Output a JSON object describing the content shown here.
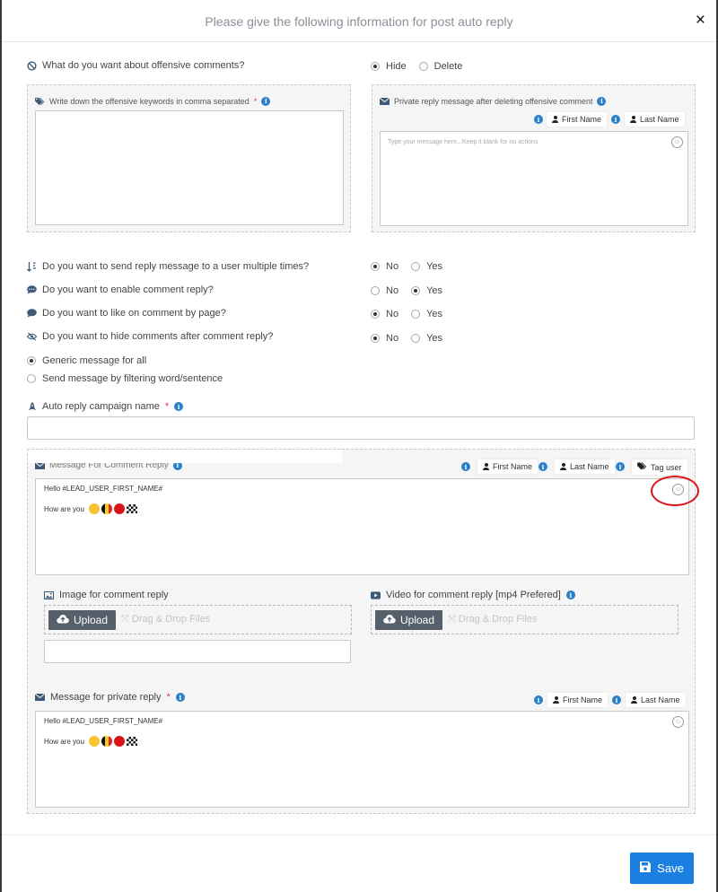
{
  "modal": {
    "title": "Please give the following information for post auto reply",
    "close_symbol": "×"
  },
  "offensive": {
    "question": "What do you want about offensive comments?",
    "options": [
      "Hide",
      "Delete"
    ],
    "selected": "Hide",
    "keywords_label": "Write down the offensive keywords in comma separated",
    "keywords_value": "",
    "private_label": "Private reply message after deleting offensive comment",
    "private_placeholder": "Type your message here...Keep it blank for no actions"
  },
  "chips": {
    "first_name": "First Name",
    "last_name": "Last Name",
    "tag_user": "Tag user"
  },
  "questions": [
    {
      "icon": "sort-icon",
      "text": "Do you want to send reply message to a user multiple times?",
      "options": [
        "No",
        "Yes"
      ],
      "selected": "No"
    },
    {
      "icon": "comment-dots-icon",
      "text": "Do you want to enable comment reply?",
      "options": [
        "No",
        "Yes"
      ],
      "selected": "Yes"
    },
    {
      "icon": "comment-icon",
      "text": "Do you want to like on comment by page?",
      "options": [
        "No",
        "Yes"
      ],
      "selected": "No"
    },
    {
      "icon": "eye-slash-icon",
      "text": "Do you want to hide comments after comment reply?",
      "options": [
        "No",
        "Yes"
      ],
      "selected": "No"
    }
  ],
  "message_type": {
    "options": [
      "Generic message for all",
      "Send message by filtering word/sentence"
    ],
    "selected": "Generic message for all"
  },
  "campaign": {
    "label": "Auto reply campaign name",
    "value": ""
  },
  "comment_reply": {
    "label": "Message For Comment Reply",
    "line1": "Hello  #LEAD_USER_FIRST_NAME#",
    "line2": "How are you"
  },
  "image_reply": {
    "label": "Image for comment reply",
    "upload": "Upload",
    "drop": "Drag & Drop Files"
  },
  "video_reply": {
    "label": "Video for comment reply [mp4 Prefered]",
    "upload": "Upload",
    "drop": "Drag & Drop Files"
  },
  "private_reply": {
    "label": "Message for private reply",
    "line1": "Hello  #LEAD_USER_FIRST_NAME#",
    "line2": "How are you"
  },
  "save_label": "Save",
  "colors": {
    "accent": "#1a7fe0",
    "info": "#2a7fc9",
    "highlight_circle": "#d9141a"
  }
}
